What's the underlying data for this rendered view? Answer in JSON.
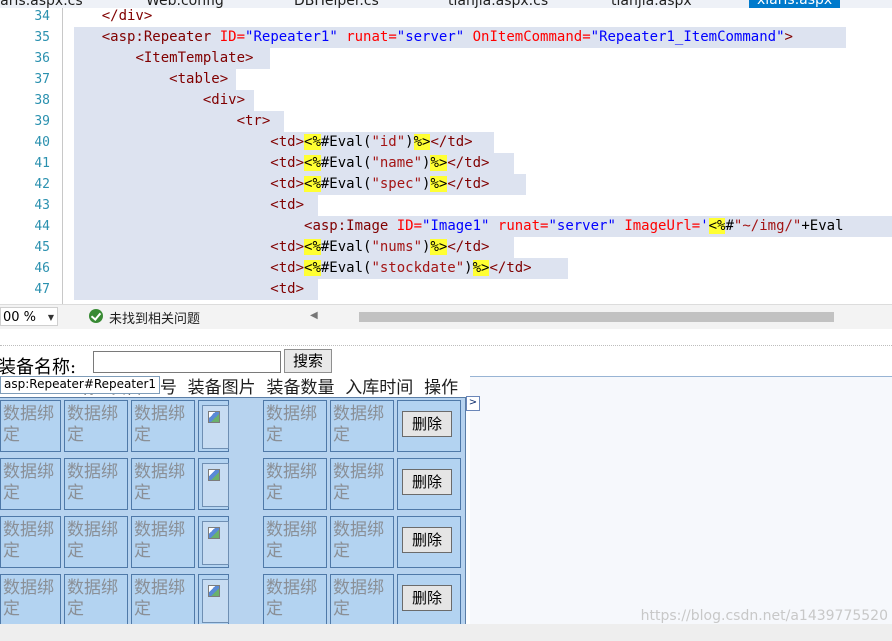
{
  "tabs": [
    {
      "label": "xiaris.aspx.cs",
      "active": false
    },
    {
      "label": "Web.config",
      "active": false
    },
    {
      "label": "DBHelper.cs",
      "active": false
    },
    {
      "label": "tianjia.aspx.cs",
      "active": false
    },
    {
      "label": "tianjia.aspx",
      "active": false
    },
    {
      "label": "xiaris.aspx",
      "active": true
    }
  ],
  "editor": {
    "line_numbers": [
      "34",
      "35",
      "36",
      "37",
      "38",
      "39",
      "40",
      "41",
      "42",
      "43",
      "44",
      "45",
      "46",
      "47"
    ],
    "lines": [
      {
        "indent": "    ",
        "parts": [
          [
            "tag",
            "</div>"
          ]
        ]
      },
      {
        "indent": "    ",
        "parts": [
          [
            "tag",
            "<asp:Repeater "
          ],
          [
            "attr",
            "ID="
          ],
          [
            "val",
            "\"Repeater1\" "
          ],
          [
            "attr",
            "runat="
          ],
          [
            "val",
            "\"server\" "
          ],
          [
            "attr",
            "OnItemCommand="
          ],
          [
            "val",
            "\"Repeater1_ItemCommand\""
          ],
          [
            "tag",
            ">"
          ]
        ]
      },
      {
        "indent": "        ",
        "parts": [
          [
            "tag",
            "<ItemTemplate>"
          ]
        ]
      },
      {
        "indent": "            ",
        "parts": [
          [
            "tag",
            "<table>"
          ]
        ]
      },
      {
        "indent": "                ",
        "parts": [
          [
            "tag",
            "<div>"
          ]
        ]
      },
      {
        "indent": "                    ",
        "parts": [
          [
            "tag",
            "<tr>"
          ]
        ]
      },
      {
        "indent": "                        ",
        "parts": [
          [
            "tag",
            "<td>"
          ],
          [
            "hl",
            "<%"
          ],
          [
            "dir",
            "#Eval("
          ],
          [
            "str",
            "\"id\""
          ],
          [
            "dir",
            ")"
          ],
          [
            "hl",
            "%>"
          ],
          [
            "tag",
            "</td>"
          ]
        ]
      },
      {
        "indent": "                        ",
        "parts": [
          [
            "tag",
            "<td>"
          ],
          [
            "hl",
            "<%"
          ],
          [
            "dir",
            "#Eval("
          ],
          [
            "str",
            "\"name\""
          ],
          [
            "dir",
            ")"
          ],
          [
            "hl",
            "%>"
          ],
          [
            "tag",
            "</td>"
          ]
        ]
      },
      {
        "indent": "                        ",
        "parts": [
          [
            "tag",
            "<td>"
          ],
          [
            "hl",
            "<%"
          ],
          [
            "dir",
            "#Eval("
          ],
          [
            "str",
            "\"spec\""
          ],
          [
            "dir",
            ")"
          ],
          [
            "hl",
            "%>"
          ],
          [
            "tag",
            "</td>"
          ]
        ]
      },
      {
        "indent": "                        ",
        "parts": [
          [
            "tag",
            "<td>"
          ]
        ]
      },
      {
        "indent": "                            ",
        "parts": [
          [
            "tag",
            "<asp:Image "
          ],
          [
            "attr",
            "ID="
          ],
          [
            "val",
            "\"Image1\" "
          ],
          [
            "attr",
            "runat="
          ],
          [
            "val",
            "\"server\" "
          ],
          [
            "attr",
            "ImageUrl="
          ],
          [
            "val",
            "'"
          ],
          [
            "hl",
            "<%"
          ],
          [
            "dir",
            "#"
          ],
          [
            "str",
            "\"~/img/\""
          ],
          [
            "dir",
            "+Eval"
          ]
        ]
      },
      {
        "indent": "                        ",
        "parts": [
          [
            "tag",
            "<td>"
          ],
          [
            "hl",
            "<%"
          ],
          [
            "dir",
            "#Eval("
          ],
          [
            "str",
            "\"nums\""
          ],
          [
            "dir",
            ")"
          ],
          [
            "hl",
            "%>"
          ],
          [
            "tag",
            "</td>"
          ]
        ]
      },
      {
        "indent": "                        ",
        "parts": [
          [
            "tag",
            "<td>"
          ],
          [
            "hl",
            "<%"
          ],
          [
            "dir",
            "#Eval("
          ],
          [
            "str",
            "\"stockdate\""
          ],
          [
            "dir",
            ")"
          ],
          [
            "hl",
            "%>"
          ],
          [
            "tag",
            "</td>"
          ]
        ]
      },
      {
        "indent": "                        ",
        "parts": [
          [
            "tag",
            "<td>"
          ]
        ]
      }
    ]
  },
  "statusbar": {
    "zoom": "00 %",
    "issues_text": "未找到相关问题"
  },
  "design": {
    "label": "装备名称:",
    "search_button": "搜索",
    "repeater_tag": "asp:Repeater#Repeater1",
    "header_text": "               称  装备型号  装备图片  装备数量  入库时间  操作",
    "bound_text": "数据绑定",
    "delete_button": "删除",
    "row_count": 4
  },
  "watermark": "https://blog.csdn.net/a1439775520"
}
